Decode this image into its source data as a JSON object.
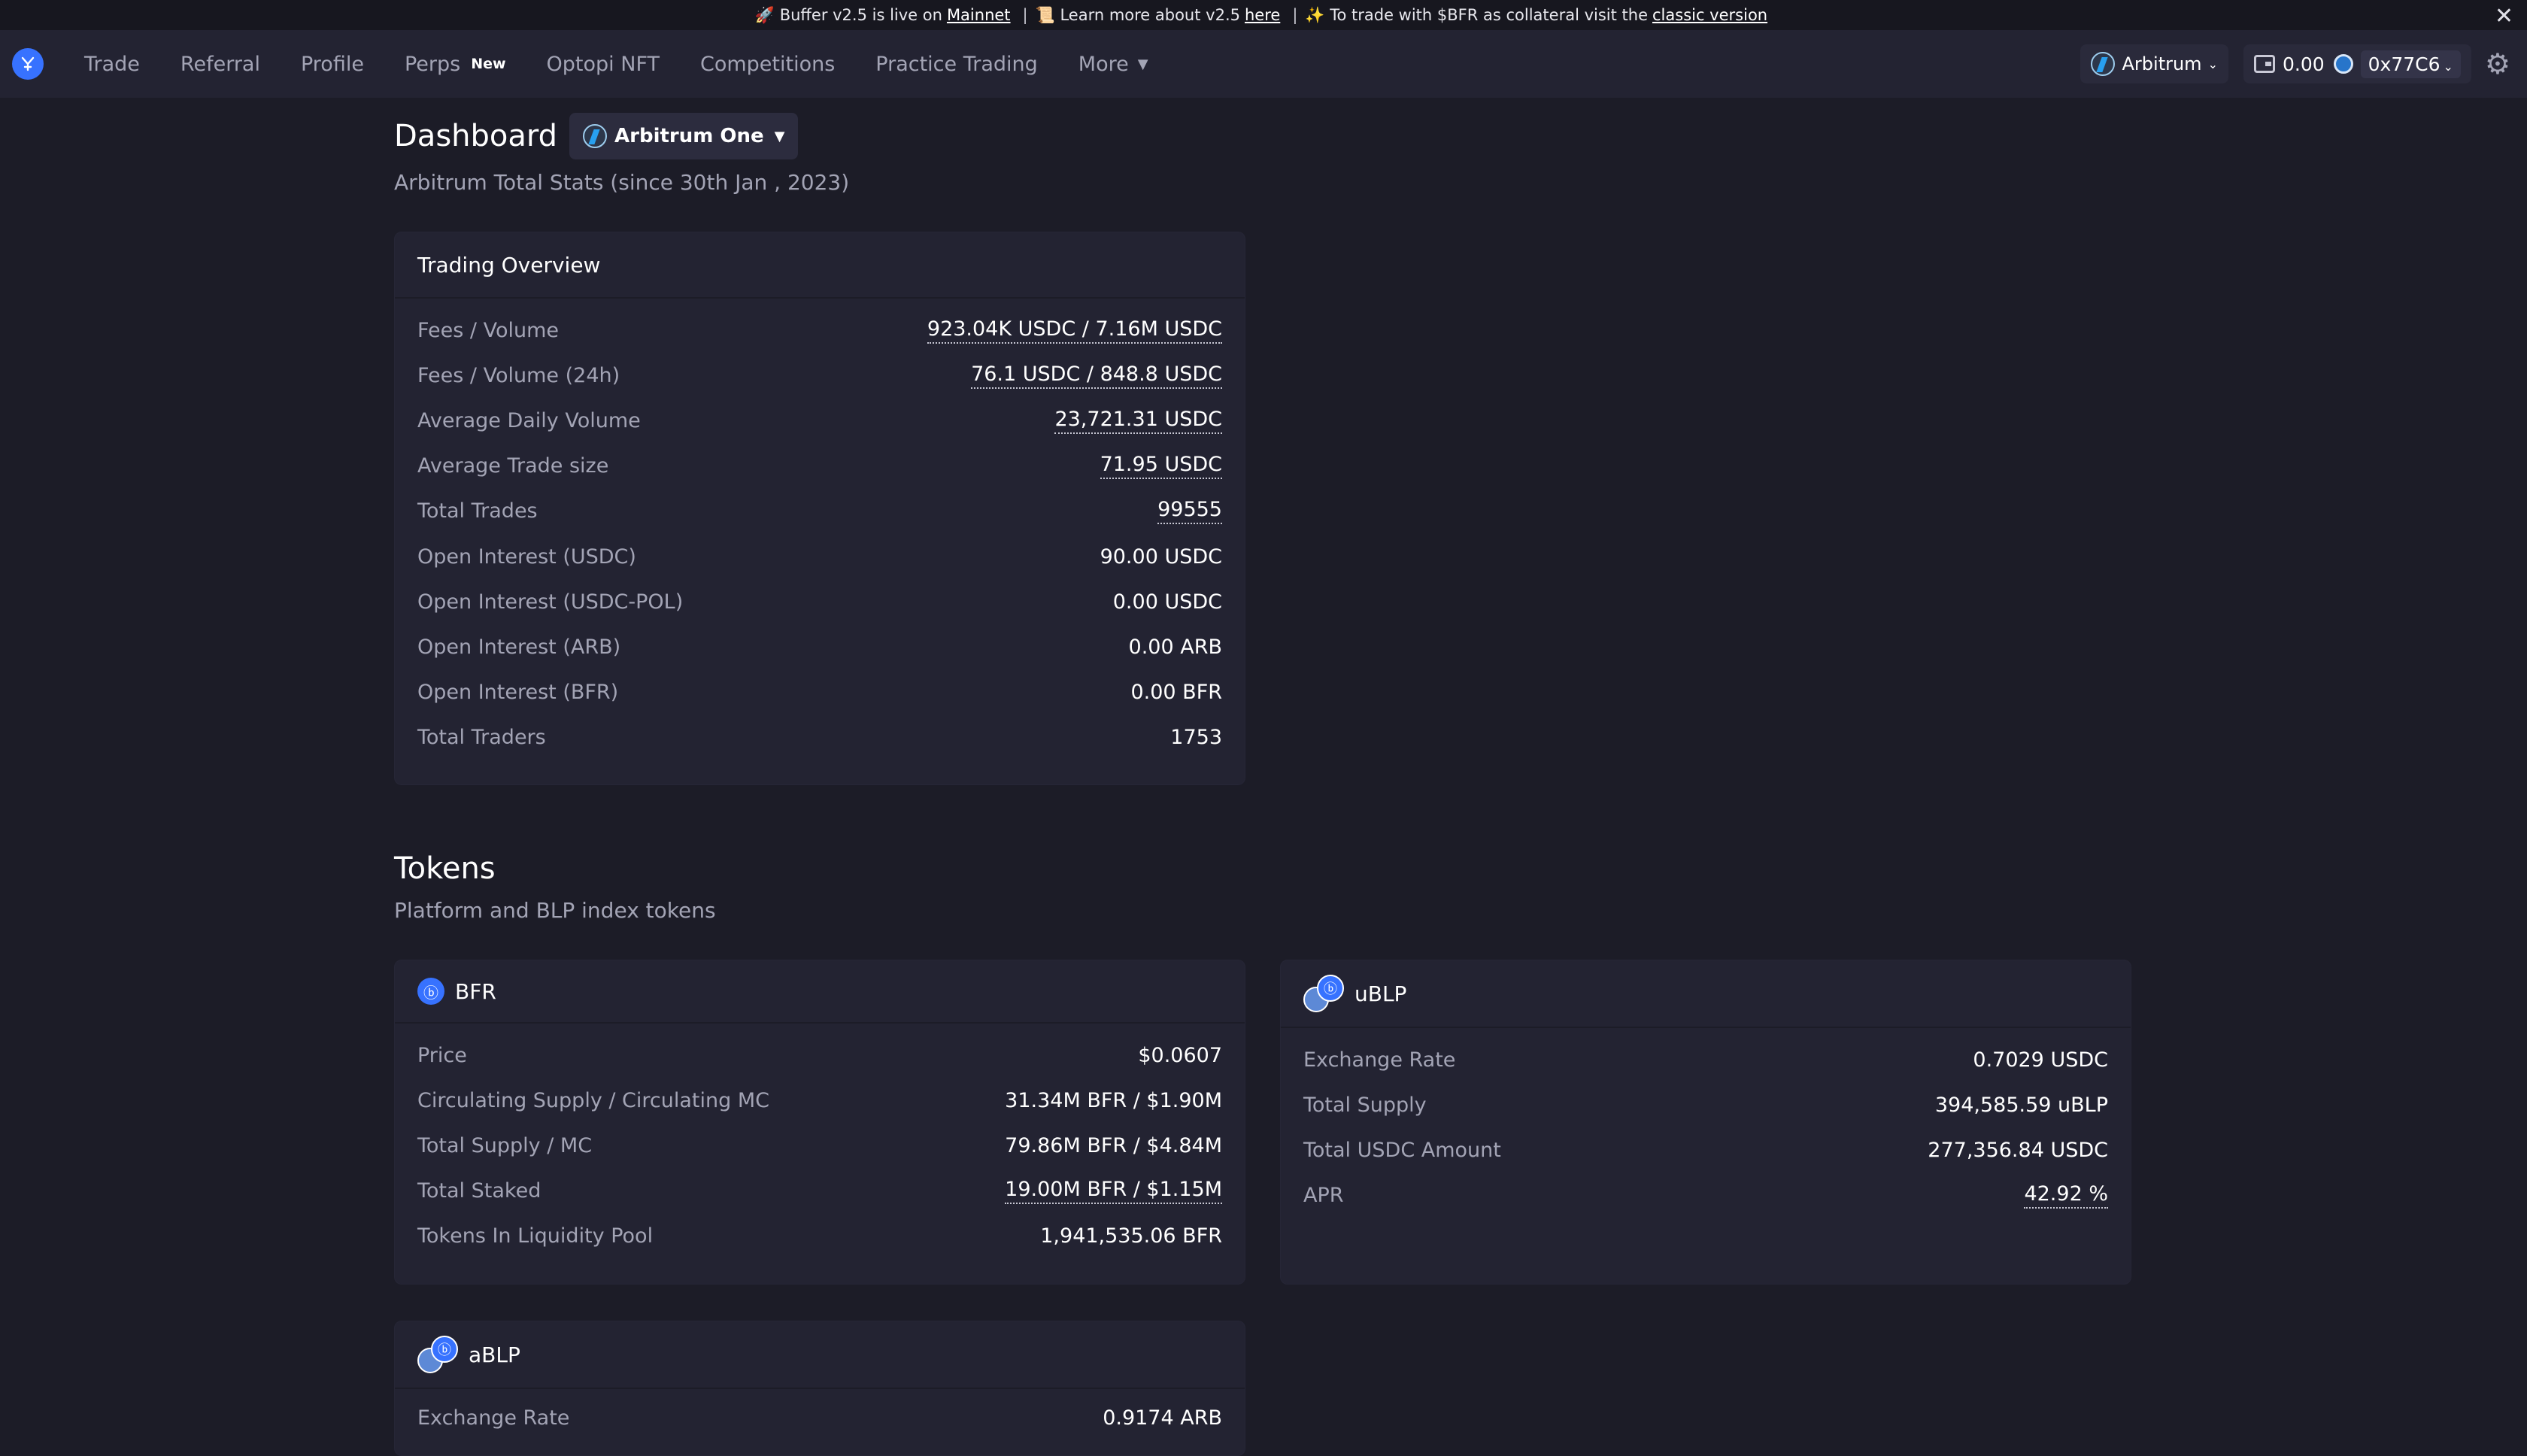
{
  "announcement": {
    "part1": "🚀 Buffer v2.5 is live on",
    "mainnet_link": "Mainnet",
    "sep1": "|",
    "part2": "📜 Learn more about v2.5",
    "here_link": "here",
    "sep2": "|",
    "part3": "✨ To trade with $BFR as collateral visit the",
    "classic_link": "classic version",
    "close": "✕"
  },
  "nav": {
    "items": [
      {
        "label": "Trade"
      },
      {
        "label": "Referral"
      },
      {
        "label": "Profile"
      },
      {
        "label": "Perps",
        "badge": "New"
      },
      {
        "label": "Optopi NFT"
      },
      {
        "label": "Competitions"
      },
      {
        "label": "Practice Trading"
      },
      {
        "label": "More"
      }
    ],
    "chain": "Arbitrum",
    "wallet_balance": "0.00",
    "address": "0x77C6"
  },
  "dashboard": {
    "title": "Dashboard",
    "network": "Arbitrum One",
    "subtitle": "Arbitrum Total Stats (since 30th Jan , 2023)"
  },
  "trading_overview": {
    "title": "Trading Overview",
    "rows": [
      {
        "k": "Fees / Volume",
        "v": "923.04K USDC / 7.16M USDC"
      },
      {
        "k": "Fees / Volume (24h)",
        "v": "76.1 USDC / 848.8 USDC"
      },
      {
        "k": "Average Daily Volume",
        "v": "23,721.31 USDC"
      },
      {
        "k": "Average Trade size",
        "v": "71.95 USDC"
      },
      {
        "k": "Total Trades",
        "v": "99555"
      },
      {
        "k": "Open Interest (USDC)",
        "v": "90.00 USDC"
      },
      {
        "k": "Open Interest (USDC-POL)",
        "v": "0.00 USDC"
      },
      {
        "k": "Open Interest (ARB)",
        "v": "0.00 ARB"
      },
      {
        "k": "Open Interest (BFR)",
        "v": "0.00 BFR"
      },
      {
        "k": "Total Traders",
        "v": "1753"
      }
    ]
  },
  "tokens": {
    "title": "Tokens",
    "subtitle": "Platform and BLP index tokens",
    "bfr": {
      "name": "BFR",
      "rows": [
        {
          "k": "Price",
          "v": "$0.0607"
        },
        {
          "k": "Circulating Supply / Circulating MC",
          "v": "31.34M BFR / $1.90M"
        },
        {
          "k": "Total Supply / MC",
          "v": "79.86M BFR / $4.84M"
        },
        {
          "k": "Total Staked",
          "v": "19.00M BFR / $1.15M"
        },
        {
          "k": "Tokens In Liquidity Pool",
          "v": "1,941,535.06 BFR"
        }
      ]
    },
    "ublp": {
      "name": "uBLP",
      "rows": [
        {
          "k": "Exchange Rate",
          "v": "0.7029 USDC"
        },
        {
          "k": "Total Supply",
          "v": "394,585.59 uBLP"
        },
        {
          "k": "Total USDC Amount",
          "v": "277,356.84 USDC"
        },
        {
          "k": "APR",
          "v": "42.92 %"
        }
      ]
    },
    "ablp": {
      "name": "aBLP",
      "rows": [
        {
          "k": "Exchange Rate",
          "v": "0.9174 ARB"
        }
      ]
    }
  }
}
